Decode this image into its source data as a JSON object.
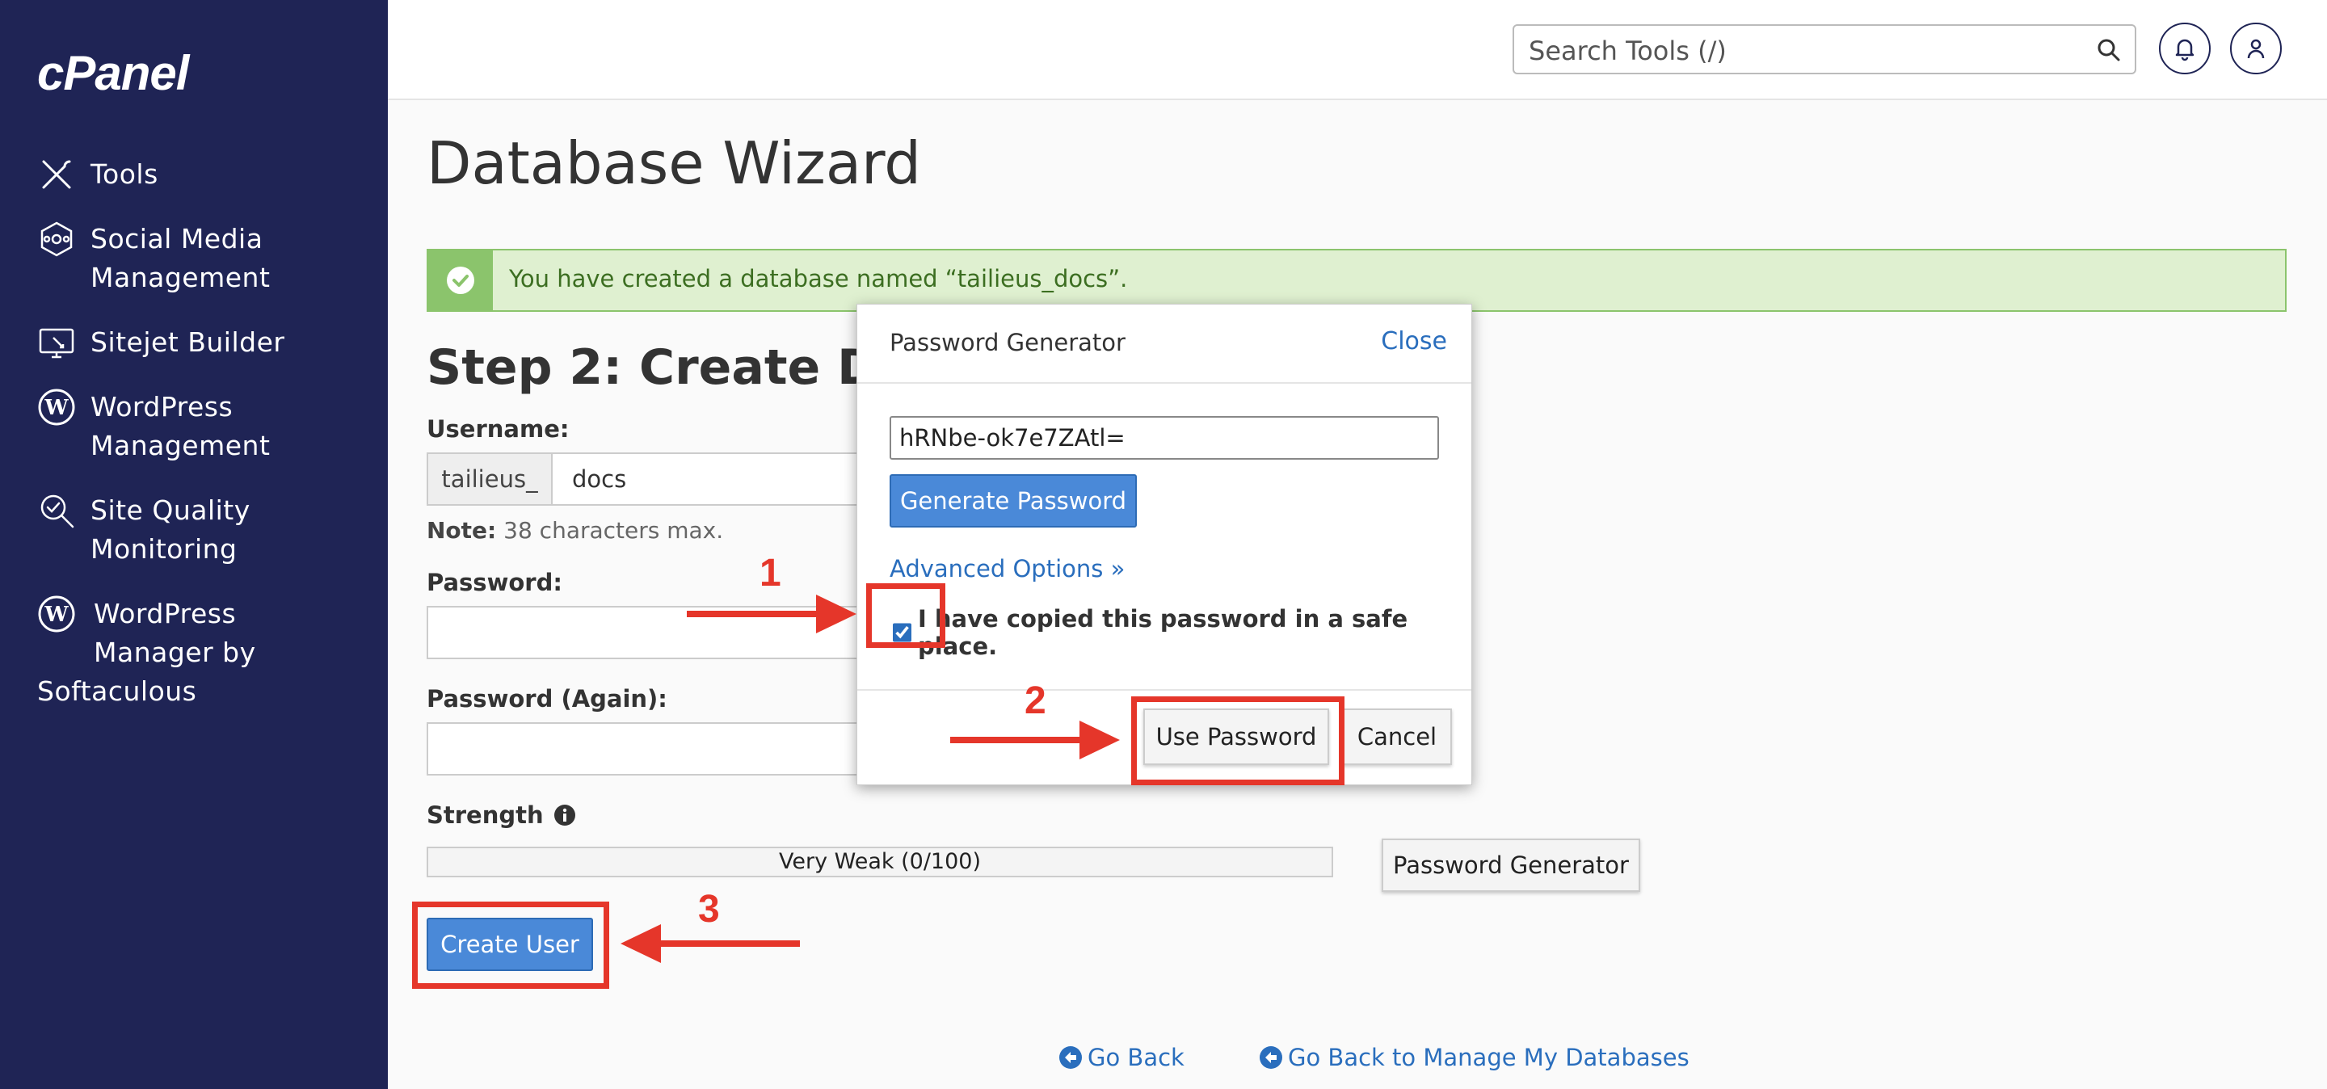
{
  "sidebar": {
    "logo": "cPanel",
    "items": [
      {
        "label": "Tools",
        "icon": "tools-icon"
      },
      {
        "label": "Social Media Management",
        "line1": "Social Media",
        "line2": "Management",
        "icon": "social-media-icon"
      },
      {
        "label": "Sitejet Builder",
        "icon": "sitejet-icon"
      },
      {
        "label": "WordPress Management",
        "line1": "WordPress",
        "line2": "Management",
        "icon": "wordpress-icon"
      },
      {
        "label": "Site Quality Monitoring",
        "line1": "Site Quality",
        "line2": "Monitoring",
        "icon": "site-quality-icon"
      },
      {
        "label": "WordPress Manager by Softaculous",
        "line1": "WordPress",
        "line2": "Manager by",
        "line3": "Softaculous",
        "icon": "wordpress-icon"
      }
    ]
  },
  "header": {
    "search_placeholder": "Search Tools (/)"
  },
  "main": {
    "title": "Database Wizard",
    "alert": "You have created a database named “tailieus_docs”.",
    "step_title": "Step 2: Create Database Users",
    "username_label": "Username:",
    "username_prefix": "tailieus_",
    "username_value": "docs",
    "note_bold": "Note:",
    "note_text": " 38 characters max.",
    "password_label": "Password:",
    "password_again_label": "Password (Again):",
    "strength_label": "Strength",
    "strength_value": "Very Weak (0/100)",
    "password_generator_button": "Password Generator",
    "create_user_button": "Create User"
  },
  "footer": {
    "go_back": "Go Back",
    "go_back_manage": "Go Back to Manage My Databases"
  },
  "modal": {
    "title": "Password Generator",
    "close": "Close",
    "generated_password": "hRNbe-ok7e7ZAtl=",
    "generate_button": "Generate Password",
    "advanced_options": "Advanced Options »",
    "copied_label": "I have copied this password in a safe place.",
    "copied_checked": true,
    "use_password_button": "Use Password",
    "cancel_button": "Cancel"
  },
  "annotations": {
    "step1": "1",
    "step2": "2",
    "step3": "3"
  },
  "colors": {
    "sidebar_bg": "#1f2455",
    "primary_button": "#4a89d8",
    "link": "#2a6ebd",
    "success_bg": "#dff0d0",
    "success_border": "#8bc46c",
    "annotation_red": "#e5362a"
  }
}
